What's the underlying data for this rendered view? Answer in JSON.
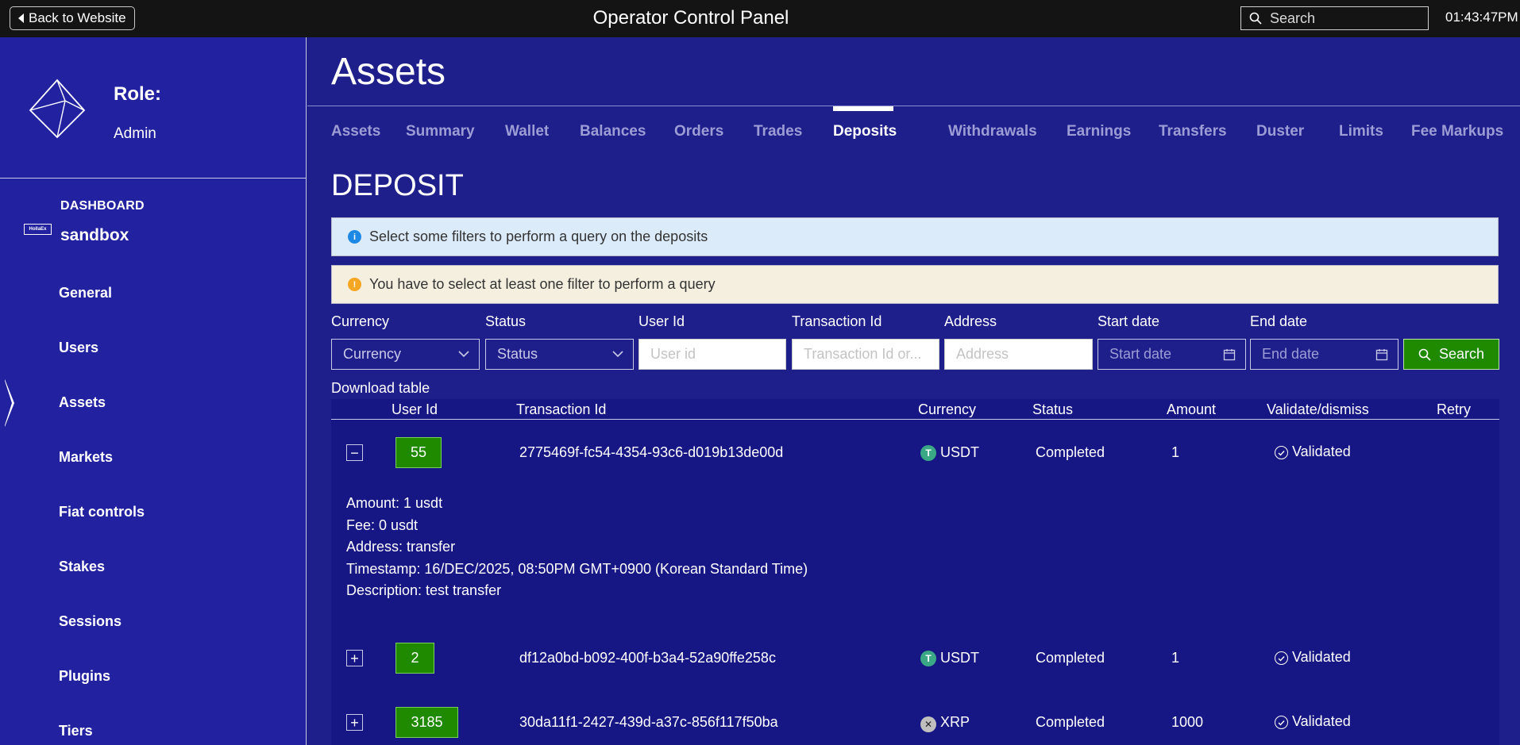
{
  "topbar": {
    "back_label": "Back to Website",
    "title": "Operator Control Panel",
    "search_placeholder": "Search",
    "time": "01:43:47PM"
  },
  "sidebar": {
    "role_title": "Role:",
    "role_value": "Admin",
    "dashboard_label": "DASHBOARD",
    "dashboard_logo_text": "HollaEx",
    "dashboard_name": "sandbox",
    "items": [
      {
        "label": "General"
      },
      {
        "label": "Users"
      },
      {
        "label": "Assets",
        "active": true
      },
      {
        "label": "Markets"
      },
      {
        "label": "Fiat controls"
      },
      {
        "label": "Stakes"
      },
      {
        "label": "Sessions"
      },
      {
        "label": "Plugins"
      },
      {
        "label": "Tiers"
      }
    ]
  },
  "main": {
    "title": "Assets",
    "tabs": [
      {
        "label": "Assets"
      },
      {
        "label": "Summary"
      },
      {
        "label": "Wallet"
      },
      {
        "label": "Balances"
      },
      {
        "label": "Orders"
      },
      {
        "label": "Trades"
      },
      {
        "label": "Deposits",
        "active": true
      },
      {
        "label": "Withdrawals"
      },
      {
        "label": "Earnings"
      },
      {
        "label": "Transfers"
      },
      {
        "label": "Duster"
      },
      {
        "label": "Limits"
      },
      {
        "label": "Fee Markups"
      }
    ],
    "section_title": "DEPOSIT",
    "info_alert": "Select some filters to perform a query on the deposits",
    "warning_alert": "You have to select at least one filter to perform a query",
    "filters": {
      "currency": {
        "label": "Currency",
        "value": "Currency"
      },
      "status": {
        "label": "Status",
        "value": "Status"
      },
      "user_id": {
        "label": "User Id",
        "placeholder": "User id"
      },
      "transaction_id": {
        "label": "Transaction Id",
        "placeholder": "Transaction Id or..."
      },
      "address": {
        "label": "Address",
        "placeholder": "Address"
      },
      "start_date": {
        "label": "Start date",
        "placeholder": "Start date"
      },
      "end_date": {
        "label": "End date",
        "placeholder": "End date"
      },
      "search_label": "Search"
    },
    "download_label": "Download table",
    "table": {
      "headers": {
        "user_id": "User Id",
        "transaction_id": "Transaction Id",
        "currency": "Currency",
        "status": "Status",
        "amount": "Amount",
        "validate": "Validate/dismiss",
        "retry": "Retry"
      },
      "rows": [
        {
          "expand_symbol": "−",
          "user_id": "55",
          "transaction_id": "2775469f-fc54-4354-93c6-d019b13de00d",
          "currency": "USDT",
          "coin_icon": "usdt-icon",
          "status": "Completed",
          "amount": "1",
          "validation": "Validated",
          "details": {
            "amount": "Amount: 1 usdt",
            "fee": "Fee: 0 usdt",
            "address": "Address: transfer",
            "timestamp": "Timestamp: 16/DEC/2025, 08:50PM GMT+0900 (Korean Standard Time)",
            "description": "Description: test transfer"
          }
        },
        {
          "expand_symbol": "+",
          "user_id": "2",
          "transaction_id": "df12a0bd-b092-400f-b3a4-52a90ffe258c",
          "currency": "USDT",
          "coin_icon": "usdt-icon",
          "status": "Completed",
          "amount": "1",
          "validation": "Validated"
        },
        {
          "expand_symbol": "+",
          "user_id": "3185",
          "transaction_id": "30da11f1-2427-439d-a37c-856f117f50ba",
          "currency": "XRP",
          "coin_icon": "xrp-icon",
          "status": "Completed",
          "amount": "1000",
          "validation": "Validated"
        }
      ]
    }
  },
  "colors": {
    "background": "#1f1f8c",
    "sidebar": "#2222a0",
    "topbar": "#141414",
    "table": "#161684",
    "success_green": "#1f8a00",
    "inactive_tab": "#9d9dd6"
  }
}
